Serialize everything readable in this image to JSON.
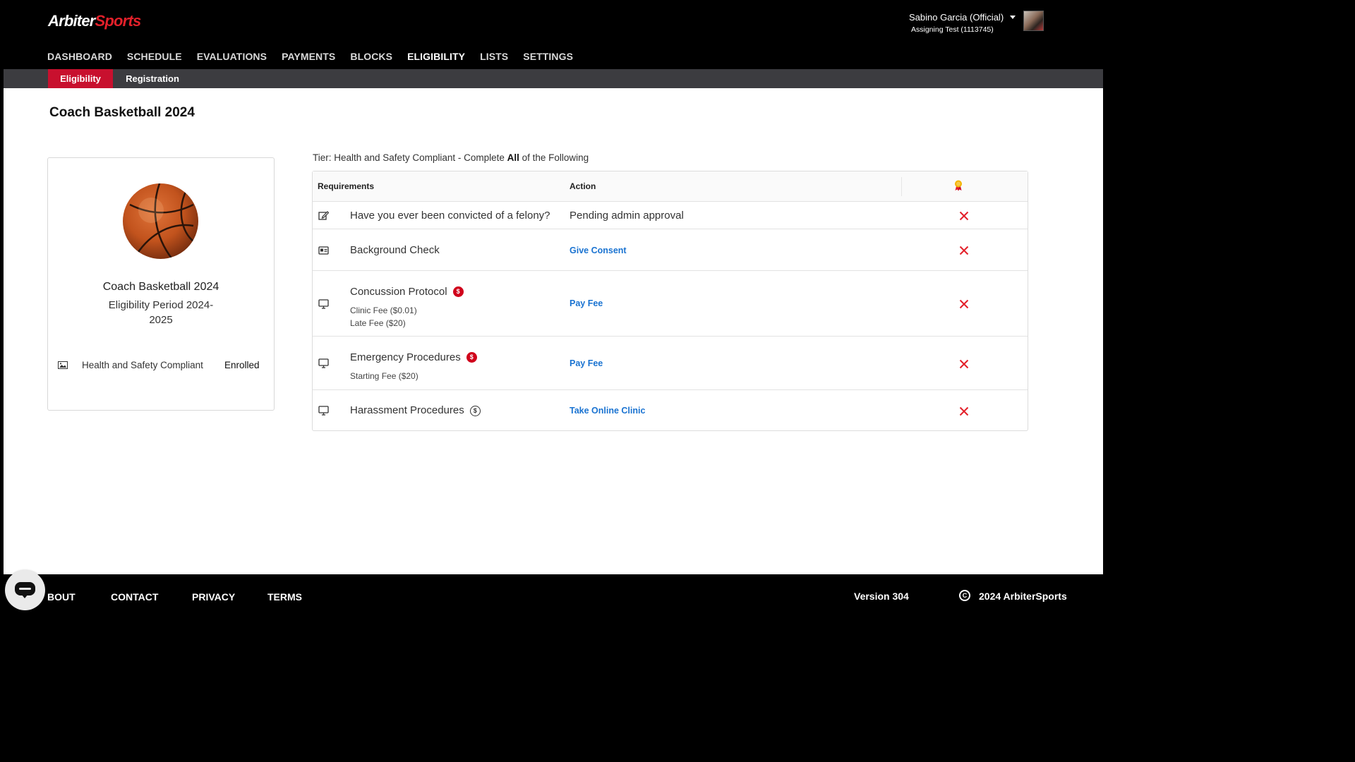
{
  "header": {
    "logo_part1": "Arbiter",
    "logo_part2": "Sports",
    "user_name": "Sabino Garcia (Official)",
    "user_group": "Assigning Test (1113745)"
  },
  "nav": {
    "items": [
      {
        "label": "DASHBOARD"
      },
      {
        "label": "SCHEDULE"
      },
      {
        "label": "EVALUATIONS"
      },
      {
        "label": "PAYMENTS"
      },
      {
        "label": "BLOCKS"
      },
      {
        "label": "ELIGIBILITY",
        "active": true
      },
      {
        "label": "LISTS"
      },
      {
        "label": "SETTINGS"
      }
    ]
  },
  "subnav": {
    "tabs": [
      {
        "label": "Eligibility",
        "active": true
      },
      {
        "label": "Registration"
      }
    ]
  },
  "page": {
    "title": "Coach Basketball 2024"
  },
  "card": {
    "title": "Coach Basketball 2024",
    "period": "Eligibility Period 2024-2025",
    "tier_name": "Health and Safety Compliant",
    "tier_status": "Enrolled"
  },
  "tier": {
    "prefix": "Tier: Health and Safety Compliant - Complete ",
    "emphasis": "All",
    "suffix": " of the Following"
  },
  "table": {
    "col_requirements": "Requirements",
    "col_action": "Action",
    "rows": [
      {
        "icon": "edit-icon",
        "name": "Have you ever been convicted of a felony?",
        "action": "Pending admin approval",
        "action_is_link": false,
        "status": "incomplete"
      },
      {
        "icon": "id-card-icon",
        "name": "Background Check",
        "action": "Give Consent",
        "action_is_link": true,
        "status": "incomplete"
      },
      {
        "icon": "monitor-icon",
        "name": "Concussion Protocol",
        "fee_badge": "$",
        "fees": [
          "Clinic Fee ($0.01)",
          "Late Fee ($20)"
        ],
        "action": "Pay Fee",
        "action_is_link": true,
        "status": "incomplete"
      },
      {
        "icon": "monitor-icon",
        "name": "Emergency Procedures",
        "fee_badge": "$",
        "fees": [
          "Starting Fee ($20)"
        ],
        "action": "Pay Fee",
        "action_is_link": true,
        "status": "incomplete"
      },
      {
        "icon": "monitor-icon",
        "name": "Harassment Procedures",
        "fee_badge_outline": "$",
        "action": "Take Online Clinic",
        "action_is_link": true,
        "status": "incomplete"
      }
    ]
  },
  "footer": {
    "links": [
      "BOUT",
      "CONTACT",
      "PRIVACY",
      "TERMS"
    ],
    "version": "Version 304",
    "copyright_symbol": "C",
    "copyright": "2024 ArbiterSports"
  },
  "colors": {
    "brand_red": "#c8102e",
    "link_blue": "#1a73d1",
    "status_red": "#e3202a"
  }
}
